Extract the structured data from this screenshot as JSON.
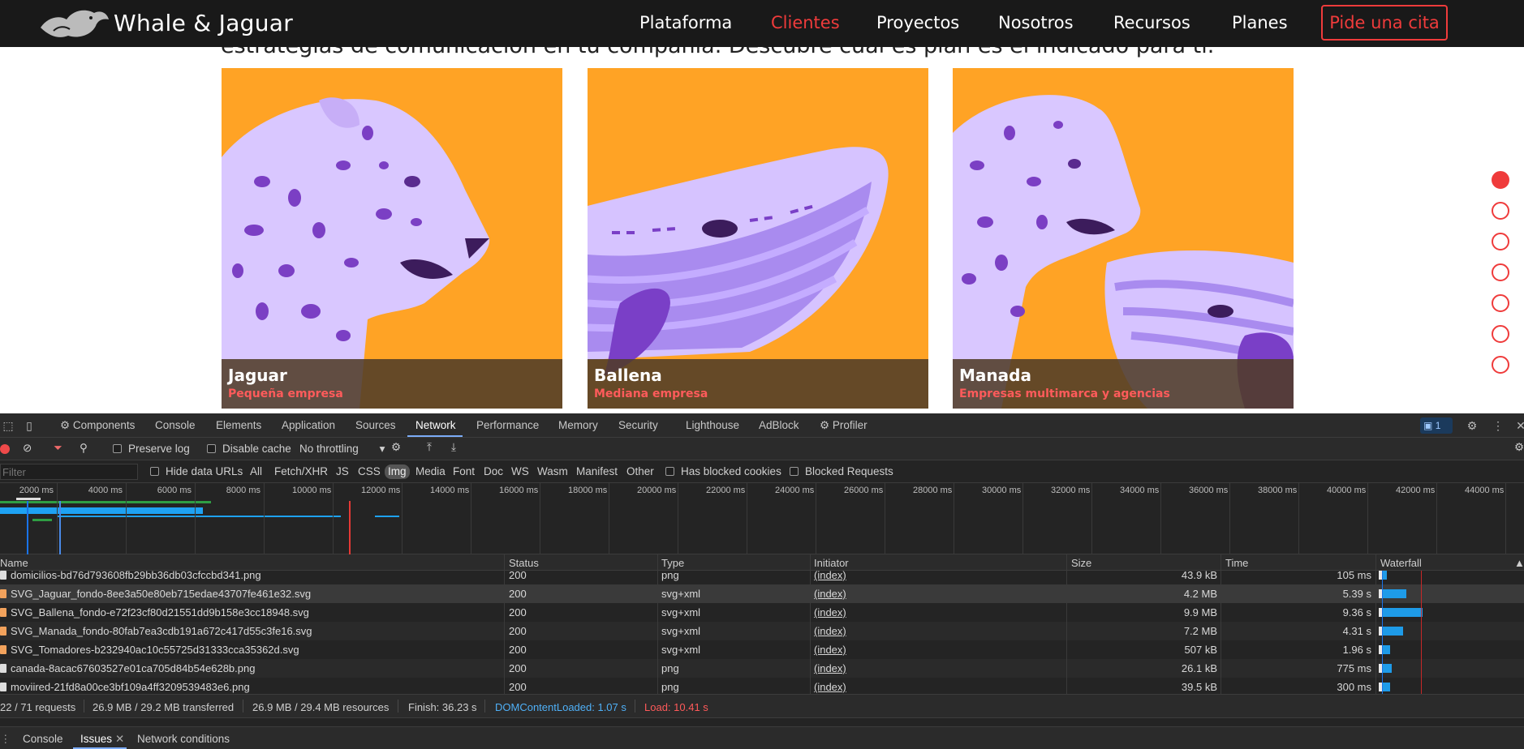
{
  "site": {
    "brand": "Whale & Jaguar",
    "nav": [
      {
        "label": "Plataforma",
        "active": false
      },
      {
        "label": "Clientes",
        "active": true
      },
      {
        "label": "Proyectos",
        "active": false
      },
      {
        "label": "Nosotros",
        "active": false
      },
      {
        "label": "Recursos",
        "active": false
      },
      {
        "label": "Planes",
        "active": false
      }
    ],
    "cta_label": "Pide una cita",
    "cut_text": "estrategias de comunicación en tu compañía. Descubre cuál es plan es el indicado para ti.",
    "cards": [
      {
        "title": "Jaguar",
        "subtitle": "Pequeña empresa"
      },
      {
        "title": "Ballena",
        "subtitle": "Mediana empresa"
      },
      {
        "title": "Manada",
        "subtitle": "Empresas multimarca y agencias"
      }
    ],
    "dots_count": 7,
    "accent": "#ef3b3b",
    "card_bg": "#ffa325"
  },
  "devtools": {
    "tabs": [
      "Components",
      "Console",
      "Elements",
      "Application",
      "Sources",
      "Network",
      "Performance",
      "Memory",
      "Security",
      "Lighthouse",
      "AdBlock",
      "Profiler"
    ],
    "active_tab": "Network",
    "issues_count": "1",
    "toolbar": {
      "preserve_log": "Preserve log",
      "disable_cache": "Disable cache",
      "throttling": "No throttling"
    },
    "filter_bar": {
      "placeholder": "Filter",
      "hide_data_urls": "Hide data URLs",
      "types": [
        "All",
        "Fetch/XHR",
        "JS",
        "CSS",
        "Img",
        "Media",
        "Font",
        "Doc",
        "WS",
        "Wasm",
        "Manifest",
        "Other"
      ],
      "selected_type": "Img",
      "has_blocked_cookies": "Has blocked cookies",
      "blocked_requests": "Blocked Requests"
    },
    "timeline_ticks": [
      "2000 ms",
      "4000 ms",
      "6000 ms",
      "8000 ms",
      "10000 ms",
      "12000 ms",
      "14000 ms",
      "16000 ms",
      "18000 ms",
      "20000 ms",
      "22000 ms",
      "24000 ms",
      "26000 ms",
      "28000 ms",
      "30000 ms",
      "32000 ms",
      "34000 ms",
      "36000 ms",
      "38000 ms",
      "40000 ms",
      "42000 ms",
      "44000 ms"
    ],
    "columns": [
      "Name",
      "Status",
      "Type",
      "Initiator",
      "Size",
      "Time",
      "Waterfall"
    ],
    "rows": [
      {
        "name": "domicilios-bd76d793608fb29bb36db03cfccbd341.png",
        "status": "200",
        "type": "png",
        "initiator": "(index)",
        "size": "43.9 kB",
        "time": "105 ms",
        "kind": "png"
      },
      {
        "name": "SVG_Jaguar_fondo-8ee3a50e80eb715edae43707fe461e32.svg",
        "status": "200",
        "type": "svg+xml",
        "initiator": "(index)",
        "size": "4.2 MB",
        "time": "5.39 s",
        "kind": "svg"
      },
      {
        "name": "SVG_Ballena_fondo-e72f23cf80d21551dd9b158e3cc18948.svg",
        "status": "200",
        "type": "svg+xml",
        "initiator": "(index)",
        "size": "9.9 MB",
        "time": "9.36 s",
        "kind": "svg"
      },
      {
        "name": "SVG_Manada_fondo-80fab7ea3cdb191a672c417d55c3fe16.svg",
        "status": "200",
        "type": "svg+xml",
        "initiator": "(index)",
        "size": "7.2 MB",
        "time": "4.31 s",
        "kind": "svg"
      },
      {
        "name": "SVG_Tomadores-b232940ac10c55725d31333cca35362d.svg",
        "status": "200",
        "type": "svg+xml",
        "initiator": "(index)",
        "size": "507 kB",
        "time": "1.96 s",
        "kind": "svg"
      },
      {
        "name": "canada-8acac67603527e01ca705d84b54e628b.png",
        "status": "200",
        "type": "png",
        "initiator": "(index)",
        "size": "26.1 kB",
        "time": "775 ms",
        "kind": "png"
      },
      {
        "name": "moviired-21fd8a00ce3bf109a4ff3209539483e6.png",
        "status": "200",
        "type": "png",
        "initiator": "(index)",
        "size": "39.5 kB",
        "time": "300 ms",
        "kind": "png"
      }
    ],
    "summary": {
      "requests": "22 / 71 requests",
      "transferred": "26.9 MB / 29.2 MB transferred",
      "resources": "26.9 MB / 29.4 MB resources",
      "finish": "Finish: 36.23 s",
      "dcl": "DOMContentLoaded: 1.07 s",
      "load": "Load: 10.41 s"
    },
    "drawer": [
      "Console",
      "Issues",
      "Network conditions"
    ],
    "drawer_active": "Issues"
  }
}
